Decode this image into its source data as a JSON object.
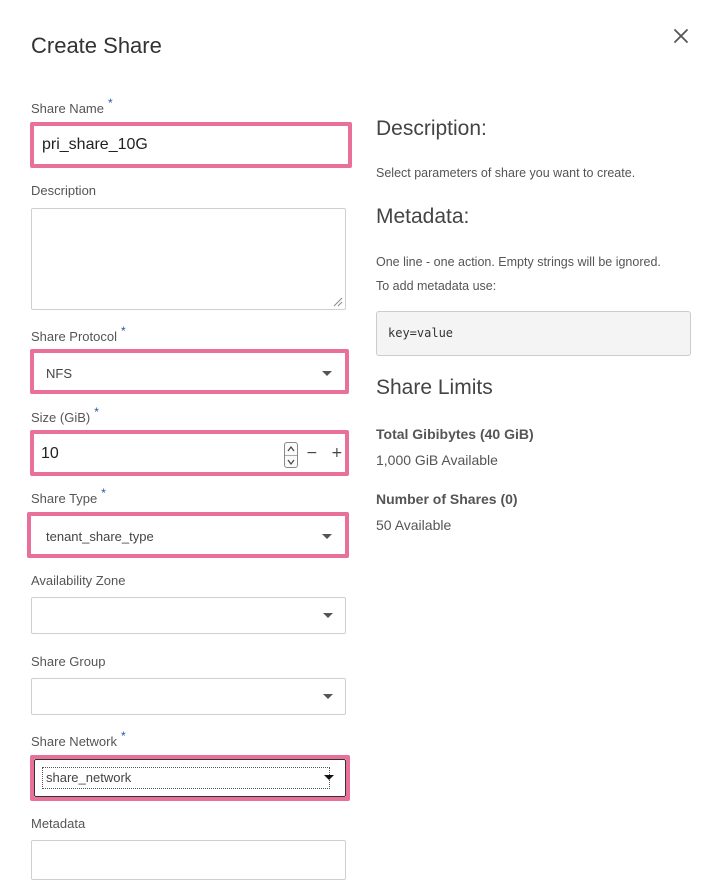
{
  "dialog": {
    "title": "Create Share",
    "close_icon": "close-icon"
  },
  "form": {
    "share_name": {
      "label": "Share Name",
      "required": "*",
      "value": "pri_share_10G"
    },
    "description": {
      "label": "Description",
      "value": ""
    },
    "share_protocol": {
      "label": "Share Protocol",
      "required": "*",
      "value": "NFS"
    },
    "size": {
      "label": "Size (GiB)",
      "required": "*",
      "value": "10",
      "minus": "−",
      "plus": "+"
    },
    "share_type": {
      "label": "Share Type",
      "required": "*",
      "value": "tenant_share_type"
    },
    "availability_zone": {
      "label": "Availability Zone",
      "value": ""
    },
    "share_group": {
      "label": "Share Group",
      "value": ""
    },
    "share_network": {
      "label": "Share Network",
      "required": "*",
      "value": "share_network"
    },
    "metadata": {
      "label": "Metadata",
      "value": ""
    }
  },
  "help": {
    "description_heading": "Description:",
    "description_text": "Select parameters of share you want to create.",
    "metadata_heading": "Metadata:",
    "metadata_line1": "One line - one action. Empty strings will be ignored.",
    "metadata_line2": "To add metadata use:",
    "metadata_code": "key=value",
    "limits_heading": "Share Limits",
    "gib_title": "Total Gibibytes (40 GiB)",
    "gib_available": "1,000 GiB Available",
    "shares_title": "Number of Shares (0)",
    "shares_available": "50 Available"
  },
  "colors": {
    "highlight": "#e8709a",
    "required_star": "#1f5aa8"
  }
}
